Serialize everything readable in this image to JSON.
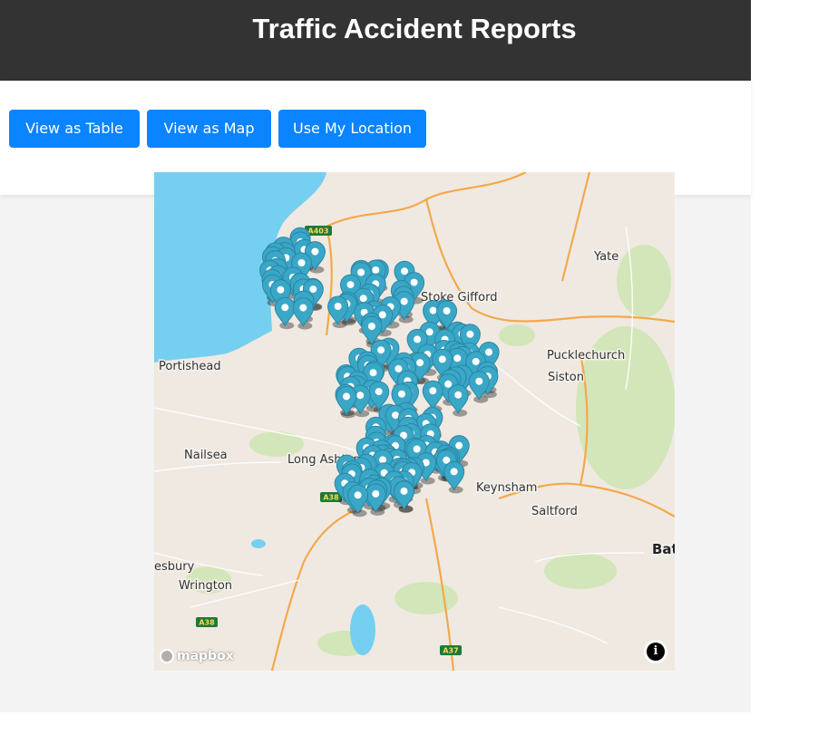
{
  "header": {
    "title": "Traffic Accident Reports"
  },
  "toolbar": {
    "table_label": "View as Table",
    "map_label": "View as Map",
    "location_label": "Use My Location"
  },
  "map": {
    "attribution_logo": "mapbox",
    "info_icon": "i",
    "marker_color": "#3aa7c7",
    "water_color": "#75cff0",
    "places": [
      {
        "name": "Yate",
        "big": false
      },
      {
        "name": "Stoke Gifford",
        "big": false
      },
      {
        "name": "Pucklechurch",
        "big": false
      },
      {
        "name": "Siston",
        "big": false
      },
      {
        "name": "Portishead",
        "big": false
      },
      {
        "name": "Nailsea",
        "big": false
      },
      {
        "name": "Long Ashton",
        "big": false
      },
      {
        "name": "Keynsham",
        "big": false
      },
      {
        "name": "Saltford",
        "big": false
      },
      {
        "name": "Bat",
        "big": true
      },
      {
        "name": "esbury",
        "big": false
      },
      {
        "name": "Wrington",
        "big": false
      }
    ],
    "road_shields": [
      "A403",
      "A38",
      "A38",
      "A37"
    ]
  }
}
